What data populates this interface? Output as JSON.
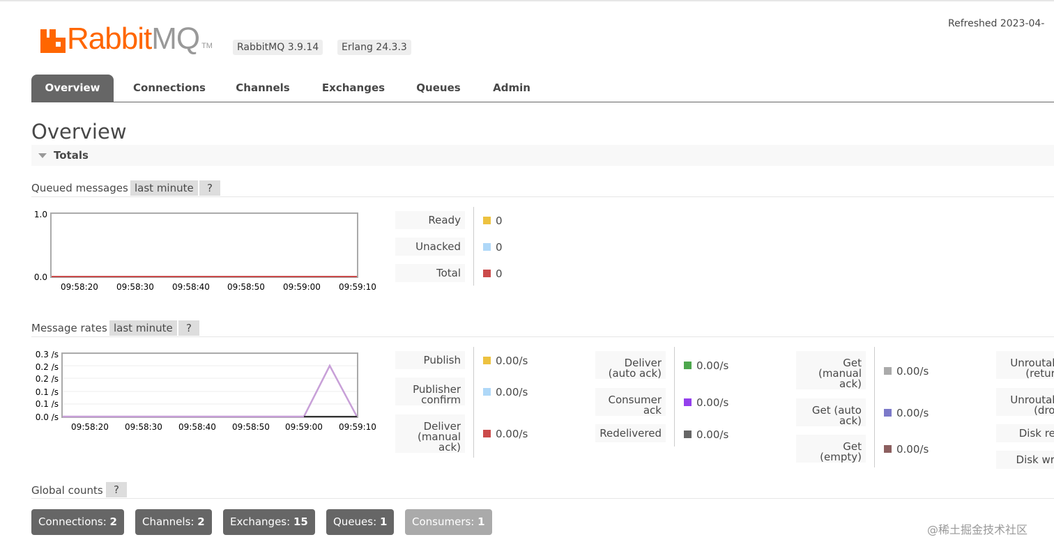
{
  "header": {
    "logo_text_main": "Rabbit",
    "logo_text_mq": "MQ",
    "logo_tm": "TM",
    "version": "RabbitMQ 3.9.14",
    "erlang": "Erlang 24.3.3",
    "refreshed": "Refreshed 2023-04-"
  },
  "tabs": [
    {
      "label": "Overview",
      "active": true
    },
    {
      "label": "Connections"
    },
    {
      "label": "Channels"
    },
    {
      "label": "Exchanges"
    },
    {
      "label": "Queues"
    },
    {
      "label": "Admin"
    }
  ],
  "page_title": "Overview",
  "totals_label": "Totals",
  "queued": {
    "label": "Queued messages",
    "range": "last minute",
    "help": "?",
    "legend": [
      {
        "label": "Ready",
        "value": "0",
        "color": "#edc240"
      },
      {
        "label": "Unacked",
        "value": "0",
        "color": "#afd8f8"
      },
      {
        "label": "Total",
        "value": "0",
        "color": "#cb4b4b"
      }
    ]
  },
  "rates": {
    "label": "Message rates",
    "range": "last minute",
    "help": "?",
    "col1": [
      {
        "label": [
          "Publish"
        ],
        "value": "0.00/s",
        "color": "#edc240"
      },
      {
        "label": [
          "Publisher",
          "confirm"
        ],
        "value": "0.00/s",
        "color": "#afd8f8"
      },
      {
        "label": [
          "Deliver",
          "(manual",
          "ack)"
        ],
        "value": "0.00/s",
        "color": "#cb4b4b"
      }
    ],
    "col2": [
      {
        "label": [
          "Deliver",
          "(auto ack)"
        ],
        "value": "0.00/s",
        "color": "#4da74d"
      },
      {
        "label": [
          "Consumer",
          "ack"
        ],
        "value": "0.00/s",
        "color": "#9440ed"
      },
      {
        "label": [
          "Redelivered"
        ],
        "value": "0.00/s",
        "color": "#666666"
      }
    ],
    "col3": [
      {
        "label": [
          "Get",
          "(manual",
          "ack)"
        ],
        "value": "0.00/s",
        "color": "#aaaaaa"
      },
      {
        "label": [
          "Get (auto",
          "ack)"
        ],
        "value": "0.00/s",
        "color": "#7c79c9"
      },
      {
        "label": [
          "Get",
          "(empty)"
        ],
        "value": "0.00/s",
        "color": "#8c5f5f"
      }
    ],
    "col4": [
      {
        "label": [
          "Unroutabl",
          "(return"
        ]
      },
      {
        "label": [
          "Unroutabl",
          "(drop"
        ]
      },
      {
        "label": [
          "Disk rea"
        ]
      },
      {
        "label": [
          "Disk writ"
        ]
      }
    ]
  },
  "global": {
    "label": "Global counts",
    "help": "?",
    "counts": [
      {
        "label": "Connections:",
        "value": "2"
      },
      {
        "label": "Channels:",
        "value": "2"
      },
      {
        "label": "Exchanges:",
        "value": "15"
      },
      {
        "label": "Queues:",
        "value": "1"
      },
      {
        "label": "Consumers:",
        "value": "1",
        "dim": true
      }
    ]
  },
  "watermark": "@稀土掘金技术社区",
  "chart_data": [
    {
      "type": "line",
      "title": "",
      "x": [
        "09:58:20",
        "09:58:30",
        "09:58:40",
        "09:58:50",
        "09:59:00",
        "09:59:10"
      ],
      "ylim": [
        0.0,
        1.0
      ],
      "yticks": [
        "1.0",
        "0.0"
      ],
      "series": [
        {
          "name": "Ready",
          "values": [
            0,
            0,
            0,
            0,
            0,
            0
          ],
          "color": "#edc240"
        },
        {
          "name": "Unacked",
          "values": [
            0,
            0,
            0,
            0,
            0,
            0
          ],
          "color": "#afd8f8"
        },
        {
          "name": "Total",
          "values": [
            0,
            0,
            0,
            0,
            0,
            0
          ],
          "color": "#cb4b4b"
        }
      ]
    },
    {
      "type": "line",
      "title": "",
      "x": [
        "09:58:20",
        "09:58:30",
        "09:58:40",
        "09:58:50",
        "09:59:00",
        "09:59:10"
      ],
      "ylim": [
        0.0,
        0.3
      ],
      "yticks": [
        "0.3 /s",
        "0.2 /s",
        "0.2 /s",
        "0.1 /s",
        "0.1 /s",
        "0.0 /s"
      ],
      "series": [
        {
          "name": "Publish",
          "values": [
            0,
            0,
            0,
            0,
            0,
            0.2,
            0
          ],
          "color": "#c8a0d8"
        }
      ]
    }
  ]
}
